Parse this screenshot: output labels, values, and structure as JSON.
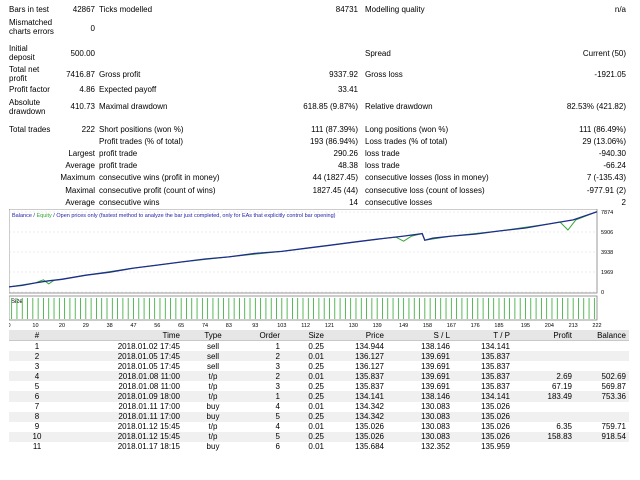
{
  "report": {
    "bars_in_test": {
      "label": "Bars in test",
      "value": "42867"
    },
    "ticks_modelled": {
      "label": "Ticks modelled",
      "value": "84731"
    },
    "modelling_quality": {
      "label": "Modelling quality",
      "value": "n/a"
    },
    "mismatched": {
      "label1": "Mismatched",
      "label2": "charts errors",
      "value": "0"
    },
    "initial_deposit": {
      "label1": "Initial",
      "label2": "deposit",
      "value": "500.00"
    },
    "spread": {
      "label": "Spread",
      "value": "Current (50)"
    },
    "total_net_profit": {
      "label1": "Total net",
      "label2": "profit",
      "value": "7416.87"
    },
    "gross_profit": {
      "label": "Gross profit",
      "value": "9337.92"
    },
    "gross_loss": {
      "label": "Gross loss",
      "value": "-1921.05"
    },
    "profit_factor": {
      "label": "Profit factor",
      "value": "4.86"
    },
    "expected_payoff": {
      "label": "Expected payoff",
      "value": "33.41"
    },
    "absolute_drawdown": {
      "label1": "Absolute",
      "label2": "drawdown",
      "value": "410.73"
    },
    "maximal_drawdown": {
      "label": "Maximal drawdown",
      "value": "618.85 (9.87%)"
    },
    "relative_drawdown": {
      "label": "Relative drawdown",
      "value": "82.53% (421.82)"
    },
    "total_trades": {
      "label": "Total trades",
      "value": "222"
    },
    "short_positions": {
      "label": "Short positions (won %)",
      "value": "111 (87.39%)"
    },
    "long_positions": {
      "label": "Long positions (won %)",
      "value": "111 (86.49%)"
    },
    "profit_trades": {
      "label": "Profit trades (% of total)",
      "value": "193 (86.94%)"
    },
    "loss_trades": {
      "label": "Loss trades (% of total)",
      "value": "29 (13.06%)"
    },
    "largest": {
      "label": "Largest",
      "profit_label": "profit trade",
      "profit_value": "290.26",
      "loss_label": "loss trade",
      "loss_value": "-940.30"
    },
    "average": {
      "label": "Average",
      "profit_label": "profit trade",
      "profit_value": "48.38",
      "loss_label": "loss trade",
      "loss_value": "-66.24"
    },
    "maximum": {
      "label": "Maximum",
      "wins_label": "consecutive wins (profit in money)",
      "wins_value": "44 (1827.45)",
      "losses_label": "consecutive losses (loss in money)",
      "losses_value": "7 (-135.43)"
    },
    "maximal": {
      "label": "Maximal",
      "wins_label": "consecutive profit (count of wins)",
      "wins_value": "1827.45 (44)",
      "losses_label": "consecutive loss (count of losses)",
      "losses_value": "-977.91 (2)"
    },
    "average_consec": {
      "label": "Average",
      "wins_label": "consecutive wins",
      "wins_value": "14",
      "losses_label": "consecutive losses",
      "losses_value": "2"
    }
  },
  "legend": {
    "balance": "Balance",
    "sep1": " / ",
    "equity": "Equity",
    "sep2": " / ",
    "note": "Open prices only (fastest method to analyze the bar just completed, only for EAs that explicitly control bar opening)"
  },
  "colors": {
    "balance": "#1f2e8c",
    "equity": "#2ea82e",
    "legend_text": "#1c1ca8",
    "size_bar": "#2ea82e"
  },
  "chart_data": {
    "type": "line",
    "series": [
      {
        "name": "Balance"
      },
      {
        "name": "Equity"
      }
    ],
    "y_ticks": [
      "7874",
      "5906",
      "3938",
      "1969",
      "0"
    ],
    "x_ticks": [
      "0",
      "10",
      "20",
      "29",
      "38",
      "47",
      "56",
      "65",
      "74",
      "83",
      "93",
      "103",
      "112",
      "121",
      "130",
      "139",
      "149",
      "158",
      "167",
      "176",
      "185",
      "195",
      "204",
      "213",
      "222"
    ],
    "ylim": [
      0,
      7874
    ],
    "size_label": "Size",
    "balance_values": [
      {
        "x": 0,
        "y": 500
      },
      {
        "x": 5,
        "y": 650
      },
      {
        "x": 10,
        "y": 900
      },
      {
        "x": 15,
        "y": 1100
      },
      {
        "x": 20,
        "y": 1250
      },
      {
        "x": 29,
        "y": 1650
      },
      {
        "x": 38,
        "y": 1950
      },
      {
        "x": 47,
        "y": 2350
      },
      {
        "x": 56,
        "y": 2650
      },
      {
        "x": 65,
        "y": 2950
      },
      {
        "x": 74,
        "y": 3250
      },
      {
        "x": 83,
        "y": 3450
      },
      {
        "x": 93,
        "y": 3800
      },
      {
        "x": 103,
        "y": 4000
      },
      {
        "x": 112,
        "y": 4300
      },
      {
        "x": 121,
        "y": 4600
      },
      {
        "x": 130,
        "y": 4900
      },
      {
        "x": 139,
        "y": 5200
      },
      {
        "x": 149,
        "y": 5500
      },
      {
        "x": 156,
        "y": 5750
      },
      {
        "x": 157,
        "y": 5100
      },
      {
        "x": 160,
        "y": 5300
      },
      {
        "x": 167,
        "y": 5500
      },
      {
        "x": 176,
        "y": 5700
      },
      {
        "x": 185,
        "y": 6000
      },
      {
        "x": 195,
        "y": 6300
      },
      {
        "x": 204,
        "y": 6700
      },
      {
        "x": 213,
        "y": 7100
      },
      {
        "x": 222,
        "y": 7900
      }
    ],
    "equity_values": [
      {
        "x": 0,
        "y": 500
      },
      {
        "x": 10,
        "y": 900
      },
      {
        "x": 13,
        "y": 1200
      },
      {
        "x": 15,
        "y": 800
      },
      {
        "x": 17,
        "y": 1150
      },
      {
        "x": 29,
        "y": 1650
      },
      {
        "x": 47,
        "y": 2350
      },
      {
        "x": 65,
        "y": 2950
      },
      {
        "x": 83,
        "y": 3450
      },
      {
        "x": 103,
        "y": 4000
      },
      {
        "x": 121,
        "y": 4600
      },
      {
        "x": 139,
        "y": 5200
      },
      {
        "x": 146,
        "y": 5400
      },
      {
        "x": 149,
        "y": 5000
      },
      {
        "x": 152,
        "y": 5500
      },
      {
        "x": 156,
        "y": 5750
      },
      {
        "x": 157,
        "y": 5100
      },
      {
        "x": 167,
        "y": 5500
      },
      {
        "x": 185,
        "y": 6000
      },
      {
        "x": 204,
        "y": 6700
      },
      {
        "x": 208,
        "y": 6900
      },
      {
        "x": 211,
        "y": 6100
      },
      {
        "x": 214,
        "y": 7100
      },
      {
        "x": 222,
        "y": 7900
      }
    ]
  },
  "table": {
    "headers": [
      "#",
      "Time",
      "Type",
      "Order",
      "Size",
      "Price",
      "S / L",
      "T / P",
      "Profit",
      "Balance"
    ],
    "rows": [
      [
        "1",
        "2018.01.02 17:45",
        "sell",
        "1",
        "0.25",
        "134.944",
        "138.146",
        "134.141",
        "",
        ""
      ],
      [
        "2",
        "2018.01.05 17:45",
        "sell",
        "2",
        "0.01",
        "136.127",
        "139.691",
        "135.837",
        "",
        ""
      ],
      [
        "3",
        "2018.01.05 17:45",
        "sell",
        "3",
        "0.25",
        "136.127",
        "139.691",
        "135.837",
        "",
        ""
      ],
      [
        "4",
        "2018.01.08 11:00",
        "t/p",
        "2",
        "0.01",
        "135.837",
        "139.691",
        "135.837",
        "2.69",
        "502.69"
      ],
      [
        "5",
        "2018.01.08 11:00",
        "t/p",
        "3",
        "0.25",
        "135.837",
        "139.691",
        "135.837",
        "67.19",
        "569.87"
      ],
      [
        "6",
        "2018.01.09 18:00",
        "t/p",
        "1",
        "0.25",
        "134.141",
        "138.146",
        "134.141",
        "183.49",
        "753.36"
      ],
      [
        "7",
        "2018.01.11 17:00",
        "buy",
        "4",
        "0.01",
        "134.342",
        "130.083",
        "135.026",
        "",
        ""
      ],
      [
        "8",
        "2018.01.11 17:00",
        "buy",
        "5",
        "0.25",
        "134.342",
        "130.083",
        "135.026",
        "",
        ""
      ],
      [
        "9",
        "2018.01.12 15:45",
        "t/p",
        "4",
        "0.01",
        "135.026",
        "130.083",
        "135.026",
        "6.35",
        "759.71"
      ],
      [
        "10",
        "2018.01.12 15:45",
        "t/p",
        "5",
        "0.25",
        "135.026",
        "130.083",
        "135.026",
        "158.83",
        "918.54"
      ],
      [
        "11",
        "2018.01.17 18:15",
        "buy",
        "6",
        "0.01",
        "135.684",
        "132.352",
        "135.959",
        "",
        ""
      ]
    ]
  }
}
